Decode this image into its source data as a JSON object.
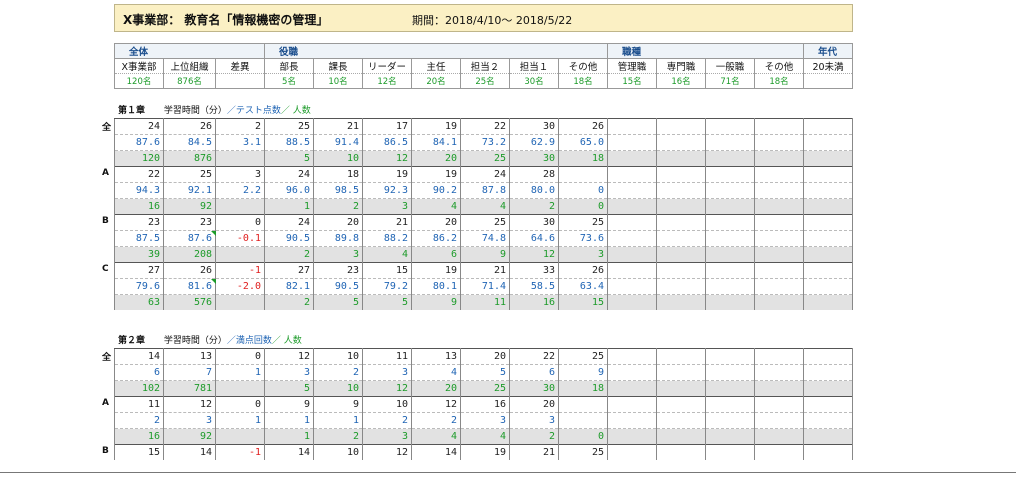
{
  "title": "X事業部： 教育名「情報機密の管理」",
  "period": "期間：2018/4/10～ 2018/5/22",
  "header": {
    "groups": [
      "全体",
      "役職",
      "職種",
      "年代"
    ],
    "columns": [
      "X事業部",
      "上位組織",
      "差異",
      "部長",
      "課長",
      "リーダー",
      "主任",
      "担当２",
      "担当１",
      "その他",
      "管理職",
      "専門職",
      "一般職",
      "その他",
      "20未満"
    ],
    "counts": [
      "120名",
      "876名",
      "",
      "5名",
      "10名",
      "12名",
      "20名",
      "25名",
      "30名",
      "18名",
      "15名",
      "16名",
      "71名",
      "18名",
      ""
    ]
  },
  "sections": [
    {
      "chapter": "第１章",
      "legend_a": "学習時間（分）",
      "legend_b": "／テスト点数",
      "legend_c": "／ 人数",
      "rows": [
        {
          "label": "全",
          "v1": [
            "24",
            "26",
            "2",
            "25",
            "21",
            "17",
            "19",
            "22",
            "30",
            "26",
            "",
            "",
            "",
            "",
            ""
          ],
          "v2": [
            "87.6",
            "84.5",
            "3.1",
            "88.5",
            "91.4",
            "86.5",
            "84.1",
            "73.2",
            "62.9",
            "65.0",
            "",
            "",
            "",
            "",
            ""
          ],
          "v3": [
            "120",
            "876",
            "",
            "5",
            "10",
            "12",
            "20",
            "25",
            "30",
            "18",
            "",
            "",
            "",
            "",
            ""
          ]
        },
        {
          "label": "A",
          "v1": [
            "22",
            "25",
            "3",
            "24",
            "18",
            "19",
            "19",
            "24",
            "28",
            "",
            "",
            "",
            "",
            "",
            ""
          ],
          "v2": [
            "94.3",
            "92.1",
            "2.2",
            "96.0",
            "98.5",
            "92.3",
            "90.2",
            "87.8",
            "80.0",
            "0",
            "",
            "",
            "",
            "",
            ""
          ],
          "v3": [
            "16",
            "92",
            "",
            "1",
            "2",
            "3",
            "4",
            "4",
            "2",
            "0",
            "",
            "",
            "",
            "",
            ""
          ]
        },
        {
          "label": "B",
          "v1": [
            "23",
            "23",
            "0",
            "24",
            "20",
            "21",
            "20",
            "25",
            "30",
            "25",
            "",
            "",
            "",
            "",
            ""
          ],
          "v2": [
            "87.5",
            "87.6",
            "-0.1",
            "90.5",
            "89.8",
            "88.2",
            "86.2",
            "74.8",
            "64.6",
            "73.6",
            "",
            "",
            "",
            "",
            ""
          ],
          "v3": [
            "39",
            "208",
            "",
            "2",
            "3",
            "4",
            "6",
            "9",
            "12",
            "3",
            "",
            "",
            "",
            "",
            ""
          ]
        },
        {
          "label": "C",
          "v1": [
            "27",
            "26",
            "-1",
            "27",
            "23",
            "15",
            "19",
            "21",
            "33",
            "26",
            "",
            "",
            "",
            "",
            ""
          ],
          "v2": [
            "79.6",
            "81.6",
            "-2.0",
            "82.1",
            "90.5",
            "79.2",
            "80.1",
            "71.4",
            "58.5",
            "63.4",
            "",
            "",
            "",
            "",
            ""
          ],
          "v3": [
            "63",
            "576",
            "",
            "2",
            "5",
            "5",
            "9",
            "11",
            "16",
            "15",
            "",
            "",
            "",
            "",
            ""
          ]
        }
      ]
    },
    {
      "chapter": "第２章",
      "legend_a": "学習時間（分）",
      "legend_b": "／満点回数",
      "legend_c": "／ 人数",
      "rows": [
        {
          "label": "全",
          "v1": [
            "14",
            "13",
            "0",
            "12",
            "10",
            "11",
            "13",
            "20",
            "22",
            "25",
            "",
            "",
            "",
            "",
            ""
          ],
          "v2": [
            "6",
            "7",
            "1",
            "3",
            "2",
            "3",
            "4",
            "5",
            "6",
            "9",
            "",
            "",
            "",
            "",
            ""
          ],
          "v3": [
            "102",
            "781",
            "",
            "5",
            "10",
            "12",
            "20",
            "25",
            "30",
            "18",
            "",
            "",
            "",
            "",
            ""
          ]
        },
        {
          "label": "A",
          "v1": [
            "11",
            "12",
            "0",
            "9",
            "9",
            "10",
            "12",
            "16",
            "20",
            "",
            "",
            "",
            "",
            "",
            ""
          ],
          "v2": [
            "2",
            "3",
            "1",
            "1",
            "1",
            "2",
            "2",
            "3",
            "3",
            "",
            "",
            "",
            "",
            "",
            ""
          ],
          "v3": [
            "16",
            "92",
            "",
            "1",
            "2",
            "3",
            "4",
            "4",
            "2",
            "0",
            "",
            "",
            "",
            "",
            ""
          ]
        },
        {
          "label": "B",
          "v1": [
            "15",
            "14",
            "-1",
            "14",
            "10",
            "12",
            "14",
            "19",
            "21",
            "25",
            "",
            "",
            "",
            "",
            ""
          ],
          "v2": [],
          "v3": []
        }
      ]
    }
  ]
}
